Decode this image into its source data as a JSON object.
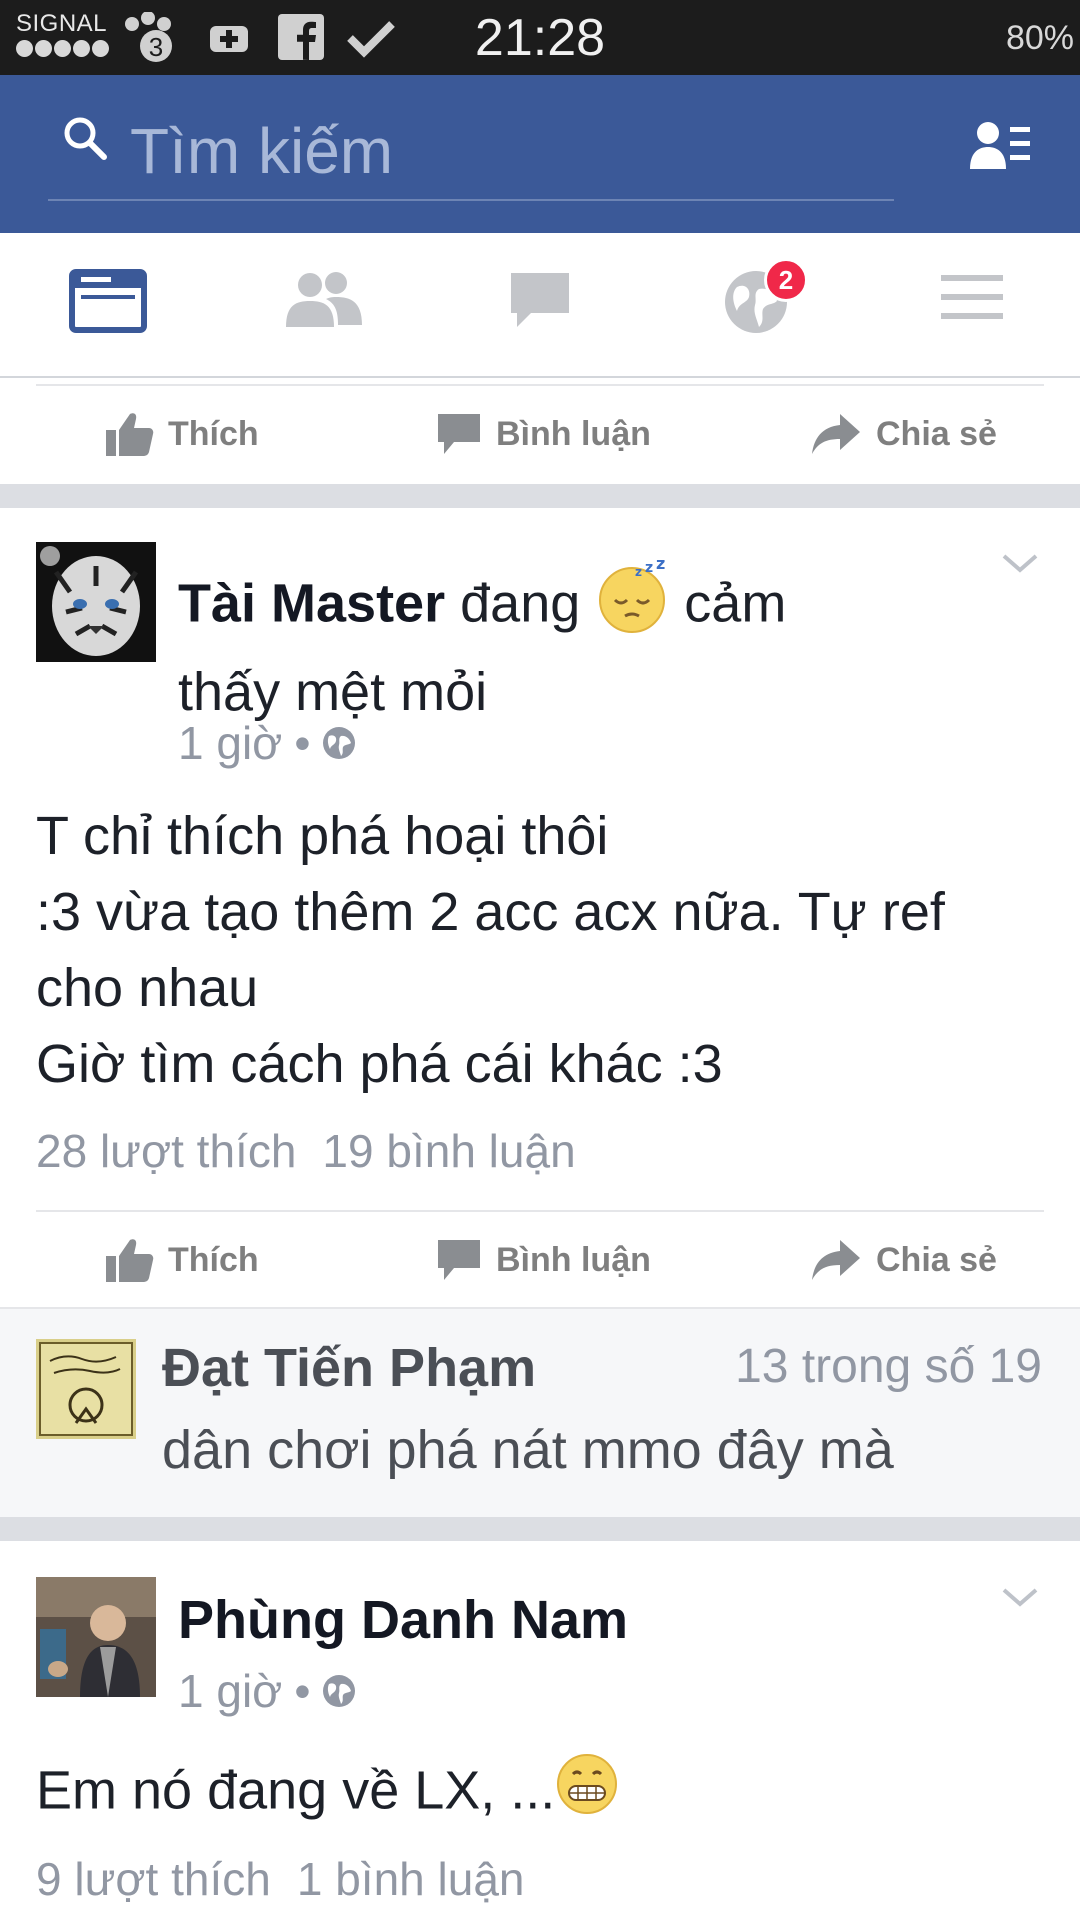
{
  "status_bar": {
    "carrier": "SIGNAL",
    "notification_badge": "3",
    "time": "21:28",
    "battery": "80%"
  },
  "search": {
    "placeholder": "Tìm kiếm"
  },
  "tabs": {
    "notifications_badge": "2"
  },
  "actions": {
    "like": "Thích",
    "comment": "Bình luận",
    "share": "Chia sẻ"
  },
  "post1": {
    "author": "Tài Master",
    "activity_prefix": "đang",
    "feeling_emoji": "sleepy-face",
    "feeling_line1": "cảm",
    "feeling_line2": "thấy mệt mỏi",
    "time": "1 giờ",
    "separator": "•",
    "privacy_icon": "globe-icon",
    "body_lines": [
      "T chỉ thích phá hoại thôi",
      ":3 vừa tạo thêm 2 acc acx nữa. Tự ref",
      "cho nhau",
      "Giờ tìm cách phá cái khác :3"
    ],
    "likes": "28 lượt thích",
    "comments": "19 bình luận"
  },
  "comment_preview": {
    "author": "Đạt Tiến Phạm",
    "position": "13 trong số 19",
    "text": "dân chơi phá nát mmo đây mà"
  },
  "post2": {
    "author": "Phùng Danh Nam",
    "time": "1 giờ",
    "separator": "•",
    "privacy_icon": "globe-icon",
    "body": "Em nó đang về LX, ...",
    "body_emoji": "grimacing-face",
    "likes": "9 lượt thích",
    "comments": "1 bình luận"
  },
  "colors": {
    "header_blue": "#3b5998",
    "status_bar": "#1c1c1c",
    "badge_red": "#f02849",
    "meta_gray": "#9197a3"
  }
}
